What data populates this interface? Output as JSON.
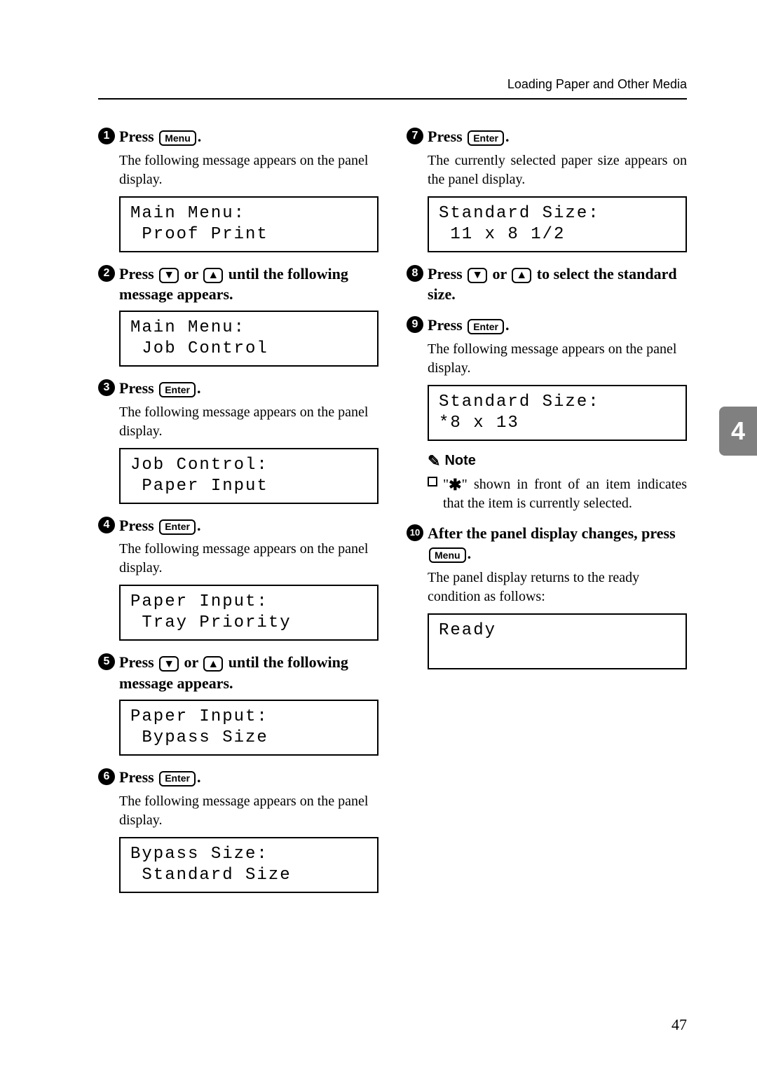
{
  "header": {
    "section_title": "Loading Paper and Other Media"
  },
  "left": {
    "s1": {
      "num": "1",
      "head_a": "Press ",
      "key": "Menu",
      "head_b": ".",
      "body": "The following message appears on the panel display.",
      "lcd1": "Main Menu:",
      "lcd2": " Proof Print"
    },
    "s2": {
      "num": "2",
      "head_a": "Press ",
      "key1": "▼",
      "mid": " or ",
      "key2": "▲",
      "head_b": " until the fol­lowing message appears.",
      "lcd1": "Main Menu:",
      "lcd2": " Job Control"
    },
    "s3": {
      "num": "3",
      "head_a": "Press ",
      "key": "Enter",
      "head_b": ".",
      "body": "The following message appears on the panel display.",
      "lcd1": "Job Control:",
      "lcd2": " Paper Input"
    },
    "s4": {
      "num": "4",
      "head_a": "Press ",
      "key": "Enter",
      "head_b": ".",
      "body": "The following message appears on the panel display.",
      "lcd1": "Paper Input:",
      "lcd2": " Tray Priority"
    },
    "s5": {
      "num": "5",
      "head_a": "Press ",
      "key1": "▼",
      "mid": " or ",
      "key2": "▲",
      "head_b": " until the fol­lowing message appears.",
      "lcd1": "Paper Input:",
      "lcd2": " Bypass Size"
    },
    "s6": {
      "num": "6",
      "head_a": "Press ",
      "key": "Enter",
      "head_b": ".",
      "body": "The following message appears on the panel display.",
      "lcd1": "Bypass Size:",
      "lcd2": " Standard Size"
    }
  },
  "right": {
    "s7": {
      "num": "7",
      "head_a": "Press ",
      "key": "Enter",
      "head_b": ".",
      "body": "The currently selected paper size appears on the panel dis­play.",
      "lcd1": "Standard Size:",
      "lcd2": " 11 x 8 1/2"
    },
    "s8": {
      "num": "8",
      "head_a": "Press ",
      "key1": "▼",
      "mid": " or ",
      "key2": "▲",
      "head_b": " to select the standard size."
    },
    "s9": {
      "num": "9",
      "head_a": "Press ",
      "key": "Enter",
      "head_b": ".",
      "body": "The following message appears on the panel display.",
      "lcd1": "Standard Size:",
      "lcd2": "*8 x 13"
    },
    "note": {
      "label": "Note",
      "item_a": "\"",
      "star": "✱",
      "item_b": "\" shown in front of an item indicates that the item is currently selected."
    },
    "s10": {
      "num": "10",
      "head_a": "After the panel display chang­es, press ",
      "key": "Menu",
      "head_b": ".",
      "body": "The panel display returns to the ready condition as follows:",
      "lcd1": "Ready",
      "lcd2": " "
    }
  },
  "side_tab": "4",
  "page_number": "47"
}
